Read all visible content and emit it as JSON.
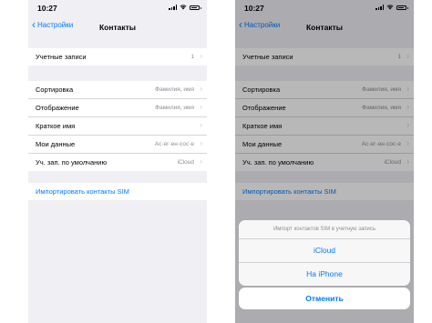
{
  "status": {
    "time": "10:27"
  },
  "nav": {
    "back_label": "Настройки",
    "title": "Контакты"
  },
  "settings": {
    "accounts": {
      "label": "Учетные записи",
      "value": "1"
    },
    "sort": {
      "label": "Сортировка",
      "value": "Фамилия, имя"
    },
    "display": {
      "label": "Отображение",
      "value": "Фамилия, имя"
    },
    "short_name": {
      "label": "Краткое имя",
      "value": ""
    },
    "my_info": {
      "label": "Мои данные",
      "value": "Ас·ег·ен·сос·е"
    },
    "default_account": {
      "label": "Уч. зап. по умолчанию",
      "value": "iCloud"
    },
    "import_sim": {
      "label": "Импортировать контакты SIM"
    }
  },
  "action_sheet": {
    "title": "Импорт контактов SIM в учетную запись",
    "options": [
      "iCloud",
      "На iPhone"
    ],
    "cancel_label": "Отменить"
  },
  "colors": {
    "accent": "#007aff",
    "background": "#efeff4",
    "secondary_text": "#8e8e93"
  }
}
